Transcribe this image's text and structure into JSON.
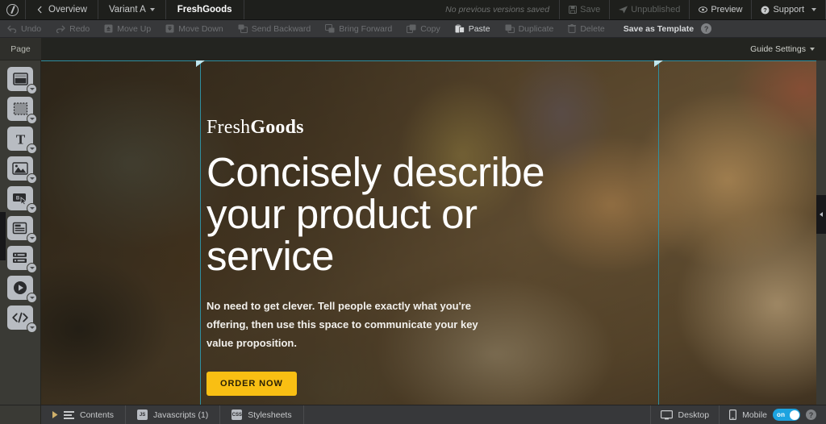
{
  "header": {
    "logo_icon": "app-logo-icon",
    "overview_label": "Overview",
    "variant_label": "Variant A",
    "page_title": "FreshGoods",
    "version_note": "No previous versions saved",
    "save_label": "Save",
    "publish_label": "Unpublished",
    "preview_label": "Preview",
    "support_label": "Support"
  },
  "toolbar": {
    "items": [
      {
        "label": "Undo",
        "icon": "undo-icon",
        "enabled": false
      },
      {
        "label": "Redo",
        "icon": "redo-icon",
        "enabled": false
      },
      {
        "label": "Move Up",
        "icon": "move-up-icon",
        "enabled": false
      },
      {
        "label": "Move Down",
        "icon": "move-down-icon",
        "enabled": false
      },
      {
        "label": "Send Backward",
        "icon": "send-backward-icon",
        "enabled": false
      },
      {
        "label": "Bring Forward",
        "icon": "bring-forward-icon",
        "enabled": false
      },
      {
        "label": "Copy",
        "icon": "copy-icon",
        "enabled": false
      },
      {
        "label": "Paste",
        "icon": "paste-icon",
        "enabled": true
      },
      {
        "label": "Duplicate",
        "icon": "duplicate-icon",
        "enabled": false
      },
      {
        "label": "Delete",
        "icon": "delete-icon",
        "enabled": false
      },
      {
        "label": "Save as Template",
        "icon": "",
        "enabled": true
      }
    ],
    "help_label": "?"
  },
  "sidebar": {
    "tab_label": "Page",
    "tools": [
      {
        "name": "section-tool",
        "label": "Section"
      },
      {
        "name": "box-tool",
        "label": "Box"
      },
      {
        "name": "text-tool",
        "label": "Text"
      },
      {
        "name": "image-tool",
        "label": "Image"
      },
      {
        "name": "button-tool",
        "label": "Button"
      },
      {
        "name": "form-tool",
        "label": "Form"
      },
      {
        "name": "list-tool",
        "label": "List"
      },
      {
        "name": "video-tool",
        "label": "Video"
      },
      {
        "name": "code-tool",
        "label": "Code"
      }
    ]
  },
  "canvas_toolbar": {
    "guide_settings_label": "Guide Settings"
  },
  "hero": {
    "brand_first": "Fresh",
    "brand_second": "Goods",
    "headline": "Concisely describe your product or service",
    "subcopy_line1": "No need to get clever. Tell people exactly what you're offering, then",
    "subcopy_line2": "use this space to communicate your key value proposition.",
    "cta_label": "ORDER NOW"
  },
  "bottombar": {
    "contents_label": "Contents",
    "javascripts_label": "Javascripts (1)",
    "javascripts_icon_text": "JS",
    "stylesheets_label": "Stylesheets",
    "stylesheets_icon_text": "CSS",
    "desktop_label": "Desktop",
    "mobile_label": "Mobile",
    "mobile_toggle_state": "on",
    "help_label": "?"
  },
  "colors": {
    "guide": "#2f8fa0",
    "cta": "#f9bf13",
    "toggle_on": "#1ca3e0",
    "header_bg": "#1e1f1c",
    "toolbar_bg": "#37383a",
    "rail_bg": "#3a3a35"
  }
}
